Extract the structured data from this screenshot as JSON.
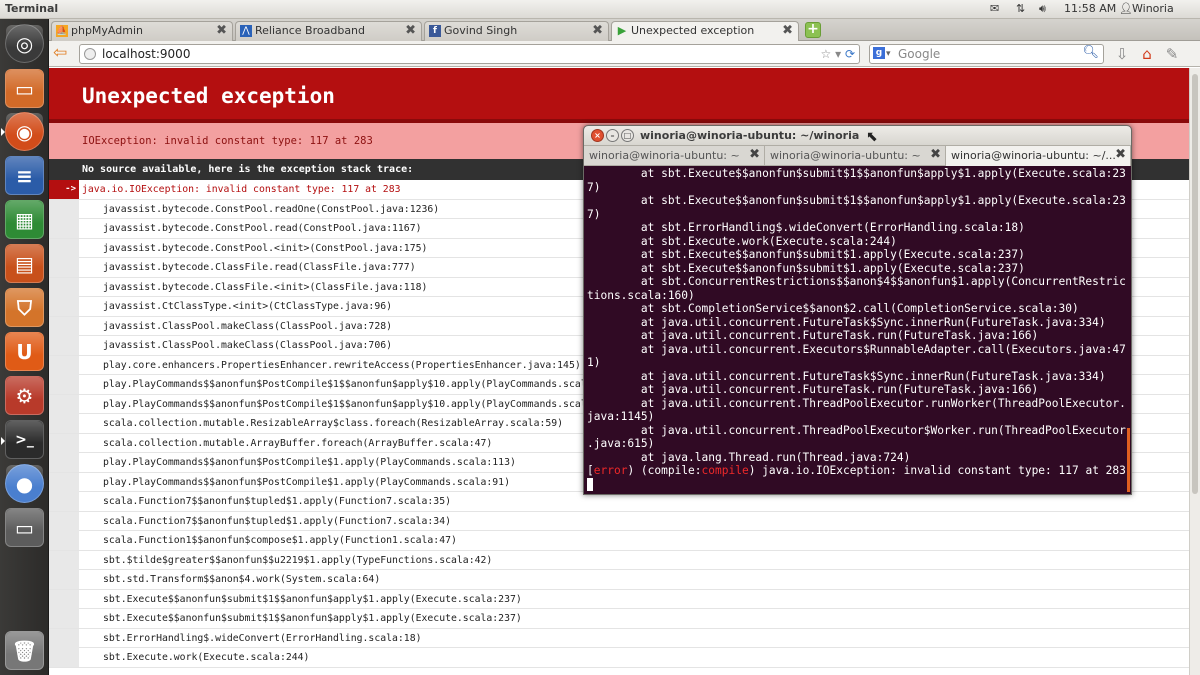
{
  "topbar": {
    "title": "Terminal",
    "time": "11:58 AM",
    "user": "Winoria"
  },
  "browser": {
    "tabs": [
      {
        "label": "phpMyAdmin"
      },
      {
        "label": "Reliance Broadband"
      },
      {
        "label": "Govind Singh"
      },
      {
        "label": "Unexpected exception"
      }
    ],
    "url": "localhost:9000",
    "search_placeholder": "Google"
  },
  "page": {
    "heading": "Unexpected exception",
    "message": "IOException: invalid constant type: 117 at 283",
    "stack_title": "No source available, here is the exception stack trace:",
    "marker": "->",
    "first_line": "java.io.IOException: invalid constant type: 117 at 283",
    "trace": [
      "javassist.bytecode.ConstPool.readOne(ConstPool.java:1236)",
      "javassist.bytecode.ConstPool.read(ConstPool.java:1167)",
      "javassist.bytecode.ConstPool.<init>(ConstPool.java:175)",
      "javassist.bytecode.ClassFile.read(ClassFile.java:777)",
      "javassist.bytecode.ClassFile.<init>(ClassFile.java:118)",
      "javassist.CtClassType.<init>(CtClassType.java:96)",
      "javassist.ClassPool.makeClass(ClassPool.java:728)",
      "javassist.ClassPool.makeClass(ClassPool.java:706)",
      "play.core.enhancers.PropertiesEnhancer.rewriteAccess(PropertiesEnhancer.java:145)",
      "play.PlayCommands$$anonfun$PostCompile$1$$anonfun$apply$10.apply(PlayCommands.scala:113)",
      "play.PlayCommands$$anonfun$PostCompile$1$$anonfun$apply$10.apply(PlayCommands.scala:113)",
      "scala.collection.mutable.ResizableArray$class.foreach(ResizableArray.scala:59)",
      "scala.collection.mutable.ArrayBuffer.foreach(ArrayBuffer.scala:47)",
      "play.PlayCommands$$anonfun$PostCompile$1.apply(PlayCommands.scala:113)",
      "play.PlayCommands$$anonfun$PostCompile$1.apply(PlayCommands.scala:91)",
      "scala.Function7$$anonfun$tupled$1.apply(Function7.scala:35)",
      "scala.Function7$$anonfun$tupled$1.apply(Function7.scala:34)",
      "scala.Function1$$anonfun$compose$1.apply(Function1.scala:47)",
      "sbt.$tilde$greater$$anonfun$$u2219$1.apply(TypeFunctions.scala:42)",
      "sbt.std.Transform$$anon$4.work(System.scala:64)",
      "sbt.Execute$$anonfun$submit$1$$anonfun$apply$1.apply(Execute.scala:237)",
      "sbt.Execute$$anonfun$submit$1$$anonfun$apply$1.apply(Execute.scala:237)",
      "sbt.ErrorHandling$.wideConvert(ErrorHandling.scala:18)",
      "sbt.Execute.work(Execute.scala:244)"
    ]
  },
  "terminal": {
    "title": "winoria@winoria-ubuntu: ~/winoria",
    "tabs": [
      {
        "label": "winoria@winoria-ubuntu: ~"
      },
      {
        "label": "winoria@winoria-ubuntu: ~"
      },
      {
        "label": "winoria@winoria-ubuntu: ~/..."
      }
    ],
    "lines": [
      "        at sbt.Execute$$anonfun$submit$1$$anonfun$apply$1.apply(Execute.scala:23",
      "7)",
      "        at sbt.Execute$$anonfun$submit$1$$anonfun$apply$1.apply(Execute.scala:23",
      "7)",
      "        at sbt.ErrorHandling$.wideConvert(ErrorHandling.scala:18)",
      "        at sbt.Execute.work(Execute.scala:244)",
      "        at sbt.Execute$$anonfun$submit$1.apply(Execute.scala:237)",
      "        at sbt.Execute$$anonfun$submit$1.apply(Execute.scala:237)",
      "        at sbt.ConcurrentRestrictions$$anon$4$$anonfun$1.apply(ConcurrentRestric",
      "tions.scala:160)",
      "        at sbt.CompletionService$$anon$2.call(CompletionService.scala:30)",
      "        at java.util.concurrent.FutureTask$Sync.innerRun(FutureTask.java:334)",
      "        at java.util.concurrent.FutureTask.run(FutureTask.java:166)",
      "        at java.util.concurrent.Executors$RunnableAdapter.call(Executors.java:47",
      "1)",
      "        at java.util.concurrent.FutureTask$Sync.innerRun(FutureTask.java:334)",
      "        at java.util.concurrent.FutureTask.run(FutureTask.java:166)",
      "        at java.util.concurrent.ThreadPoolExecutor.runWorker(ThreadPoolExecutor.",
      "java:1145)",
      "        at java.util.concurrent.ThreadPoolExecutor$Worker.run(ThreadPoolExecutor",
      ".java:615)",
      "        at java.lang.Thread.run(Thread.java:724)"
    ],
    "error_tag": "error",
    "error_pre": ") (compile:",
    "error_compile": "compile",
    "error_post": ") java.io.IOException: invalid constant type: 117 at 283"
  }
}
